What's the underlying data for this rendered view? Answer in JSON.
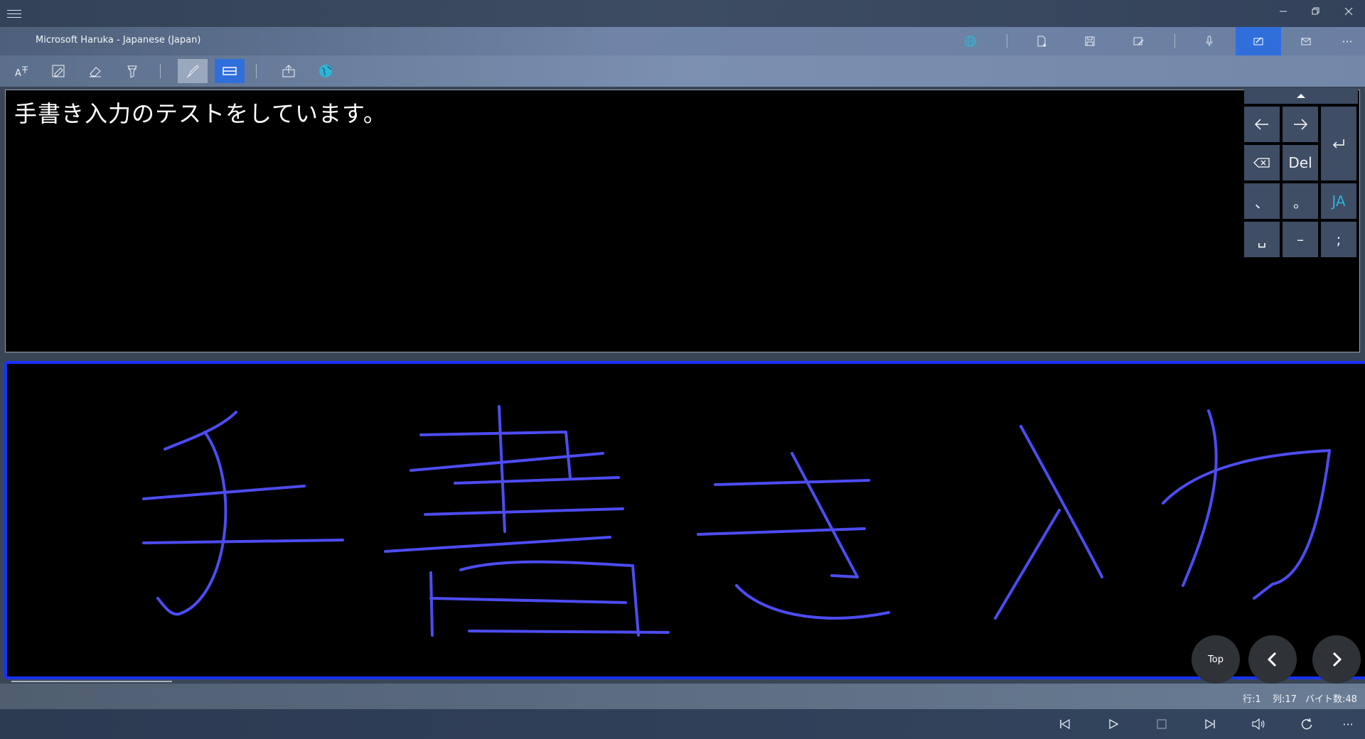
{
  "window": {
    "app_title": "Microsoft Haruka - Japanese (Japan)",
    "more_label": "···"
  },
  "editor": {
    "text": "手書き入力のテストをしています。"
  },
  "keypad": {
    "del_label": "Del",
    "comma": "、",
    "period": "。",
    "lang": "JA",
    "space": "␣",
    "dash": "–",
    "semicolon": ";"
  },
  "nav": {
    "top_label": "Top"
  },
  "status": {
    "line": "行:1",
    "column": "列:17",
    "bytes": "バイト数:48"
  },
  "player": {
    "more_label": "···"
  },
  "colors": {
    "accent": "#2f6fdc",
    "ink": "#4d4cf2",
    "canvas_border": "#1932ff",
    "lang_text": "#2fb4d6"
  }
}
